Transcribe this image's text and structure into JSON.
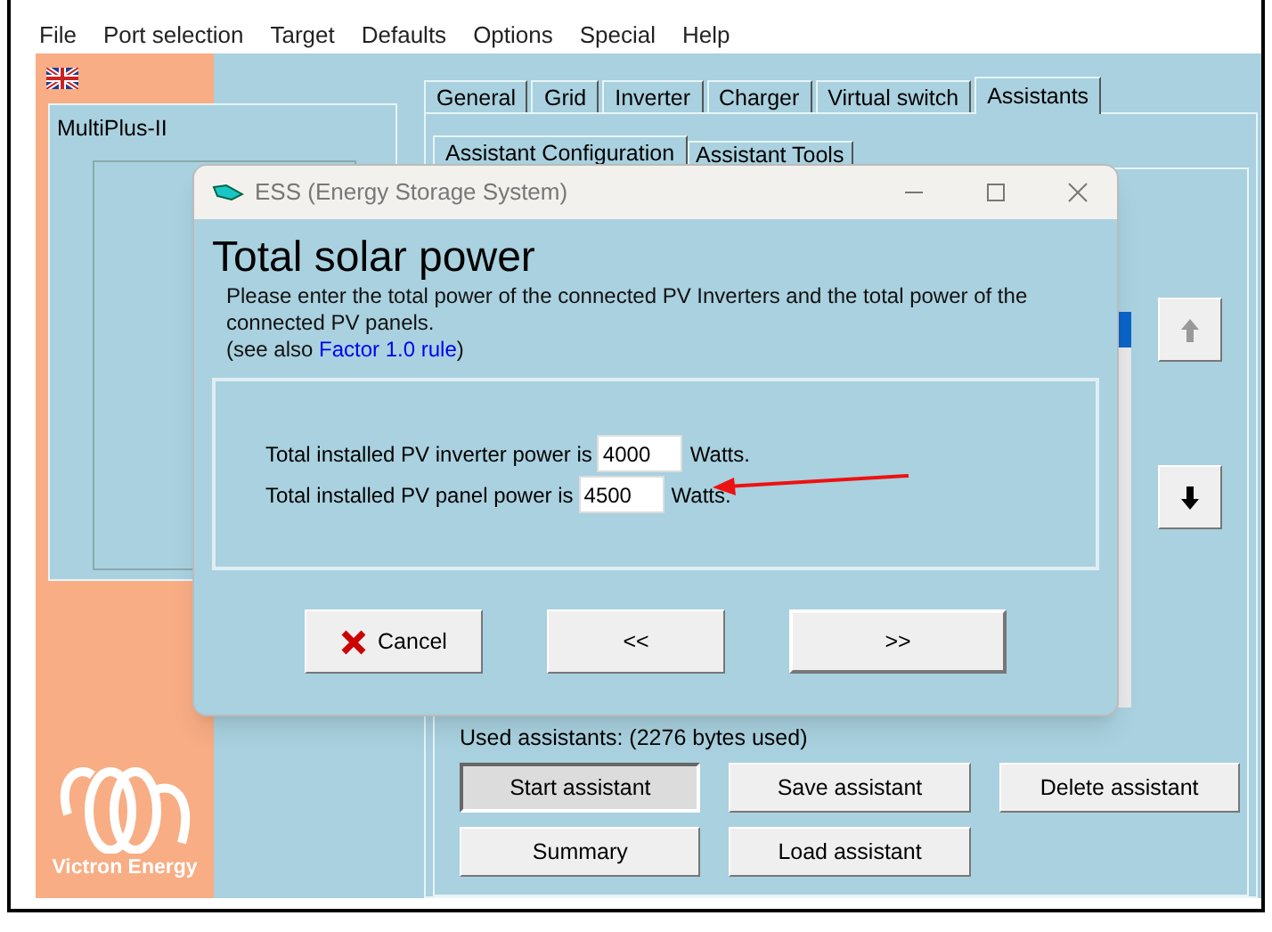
{
  "menu": [
    "File",
    "Port selection",
    "Target",
    "Defaults",
    "Options",
    "Special",
    "Help"
  ],
  "device": {
    "name": "MultiPlus-II"
  },
  "tabs": [
    {
      "label": "General",
      "selected": false
    },
    {
      "label": "Grid",
      "selected": false
    },
    {
      "label": "Inverter",
      "selected": false
    },
    {
      "label": "Charger",
      "selected": false
    },
    {
      "label": "Virtual switch",
      "selected": false
    },
    {
      "label": "Assistants",
      "selected": true
    }
  ],
  "subtabs": [
    {
      "label": "Assistant Configuration",
      "selected": true
    },
    {
      "label": "Assistant Tools",
      "selected": false
    }
  ],
  "move_buttons": [
    {
      "kind": "up",
      "disabled": true
    },
    {
      "kind": "down",
      "disabled": false
    }
  ],
  "used_assistants": "Used assistants: (2276 bytes used)",
  "assistant_buttons": [
    {
      "label": "Start assistant",
      "selected": true
    },
    {
      "label": "Save assistant",
      "selected": false
    },
    {
      "label": "Delete assistant",
      "selected": false
    },
    {
      "label": "Summary",
      "selected": false
    },
    {
      "label": "Load assistant",
      "selected": false
    }
  ],
  "logo": {
    "text": "Victron Energy"
  },
  "dialog": {
    "title": "ESS (Energy Storage System)",
    "heading": "Total solar power",
    "description": "Please enter the total power of the connected PV Inverters and the total power of the connected PV panels.",
    "see_also": {
      "prefix": "(see also",
      "link": "Factor 1.0 rule",
      "suffix": ")"
    },
    "fields": [
      {
        "label": "Total installed PV inverter power is",
        "value": "4000",
        "unit": "Watts."
      },
      {
        "label": "Total installed PV panel power is",
        "value": "4500",
        "unit": "Watts."
      }
    ],
    "buttons": [
      {
        "kind": "cancel",
        "label": "Cancel"
      },
      {
        "kind": "back",
        "label": "<<"
      },
      {
        "kind": "next",
        "label": ">>"
      }
    ]
  }
}
